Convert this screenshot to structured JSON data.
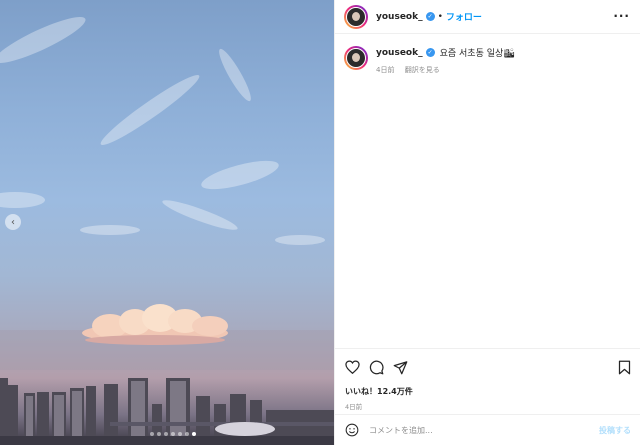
{
  "post": {
    "username": "youseok_",
    "separator": "•",
    "follow_label": "フォロー",
    "more_label": "···",
    "caption": "요즘 서초동 일상🏙",
    "caption_age": "4日前",
    "translate_label": "翻訳を見る",
    "likes_label": "いいね！12.4万件",
    "date": "4日前"
  },
  "media": {
    "prev_label": "‹",
    "carousel_count": 7,
    "carousel_active": 6
  },
  "comment": {
    "placeholder": "コメントを追加...",
    "post_label": "投稿する"
  },
  "colors": {
    "link": "#0095f6",
    "verified": "#3897f0"
  }
}
